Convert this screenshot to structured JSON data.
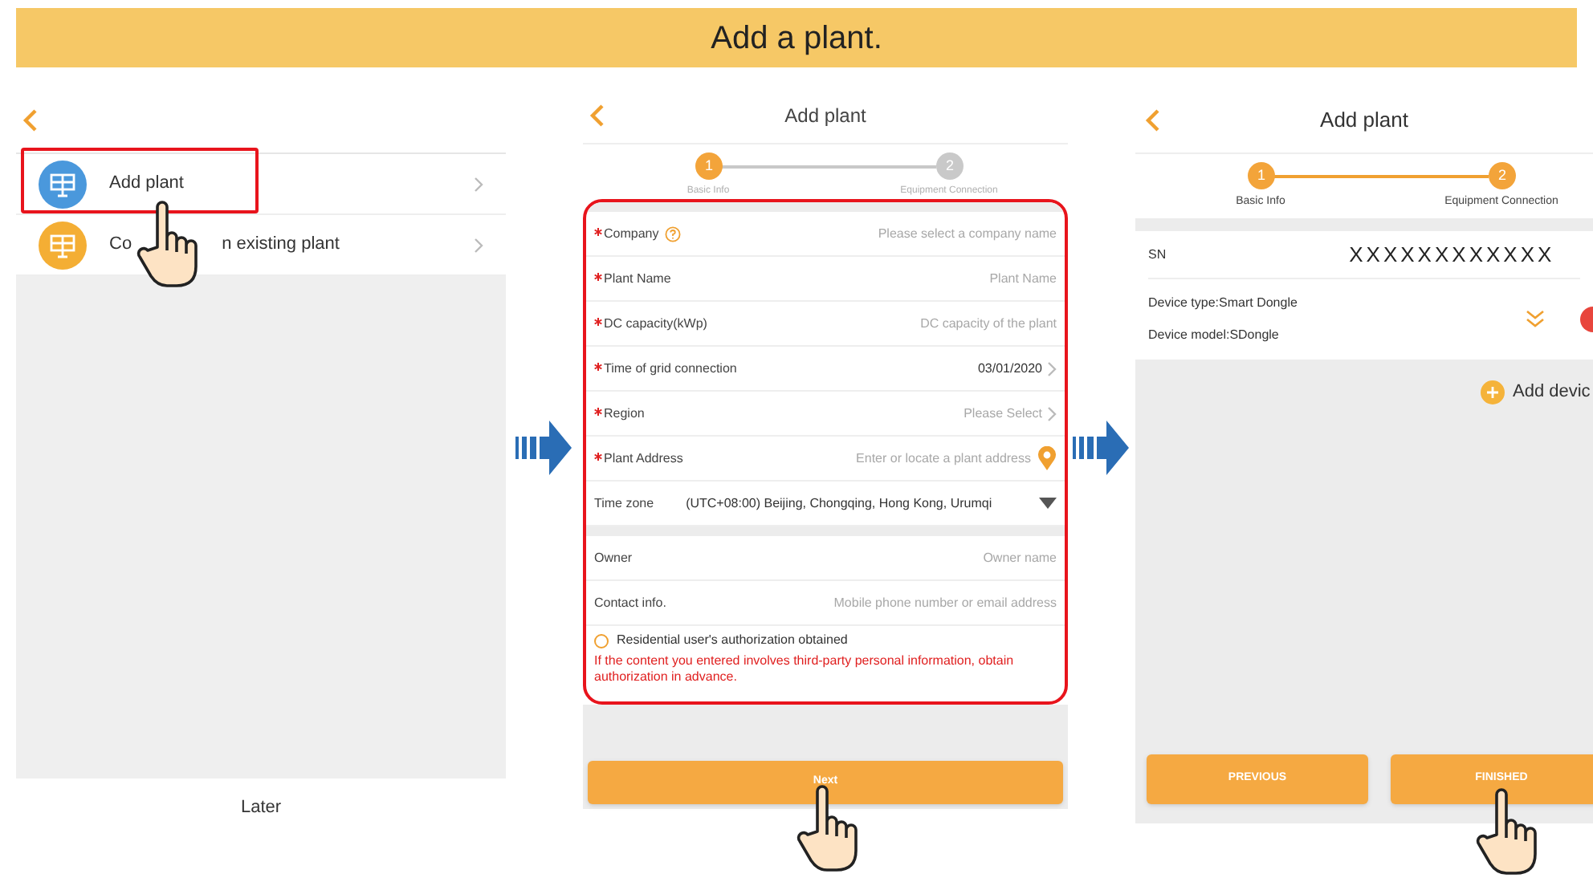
{
  "banner": {
    "title": "Add a plant."
  },
  "menu_screen": {
    "items": [
      {
        "label_parts": [
          "Add plant"
        ],
        "color": "#4a98dc",
        "highlighted": true
      },
      {
        "label_parts": [
          "Co",
          "n existing plant"
        ],
        "color": "#f4ae34",
        "highlighted": false
      }
    ],
    "later": "Later"
  },
  "form_screen": {
    "title": "Add plant",
    "steps": [
      {
        "number": "1",
        "label": "Basic Info",
        "done": true
      },
      {
        "number": "2",
        "label": "Equipment Connection",
        "done": false
      }
    ],
    "field_groups": [
      [
        {
          "kind": "text",
          "label": "Company",
          "required": true,
          "help": true,
          "placeholder": "Please select a company name"
        },
        {
          "kind": "text",
          "label": "Plant Name",
          "required": true,
          "help": false,
          "placeholder": "Plant Name"
        },
        {
          "kind": "text",
          "label": "DC capacity(kWp)",
          "required": true,
          "help": false,
          "placeholder": "DC capacity of the plant"
        },
        {
          "kind": "picker",
          "label": "Time of grid connection",
          "required": true,
          "help": false,
          "value": "03/01/2020"
        },
        {
          "kind": "picker",
          "label": "Region",
          "required": true,
          "help": false,
          "placeholder": "Please Select"
        },
        {
          "kind": "location",
          "label": "Plant Address",
          "required": true,
          "help": false,
          "placeholder": "Enter or locate a plant address"
        },
        {
          "kind": "dropdown",
          "label": "Time zone",
          "required": false,
          "help": false,
          "value": "(UTC+08:00) Beijing, Chongqing, Hong Kong, Urumqi"
        }
      ],
      [
        {
          "kind": "text",
          "label": "Owner",
          "required": false,
          "help": false,
          "placeholder": "Owner name"
        },
        {
          "kind": "text",
          "label": "Contact info.",
          "required": false,
          "help": false,
          "placeholder": "Mobile phone number or email address"
        }
      ]
    ],
    "authorization": {
      "label": "Residential user's authorization obtained",
      "checked": false,
      "warning": "If the content you entered involves third-party personal information, obtain authorization in advance."
    },
    "next_button": "Next"
  },
  "device_screen": {
    "title": "Add plant",
    "steps": [
      {
        "number": "1",
        "label": "Basic Info",
        "done": true
      },
      {
        "number": "2",
        "label": "Equipment Connection",
        "done": true
      }
    ],
    "sn_label": "SN",
    "sn_value": "XXXXXXXXXXXX",
    "device_type": "Device type:Smart Dongle",
    "device_model": "Device model:SDongle",
    "add_device": "Add devic",
    "buttons": [
      "PREVIOUS",
      "FINISHED"
    ]
  }
}
